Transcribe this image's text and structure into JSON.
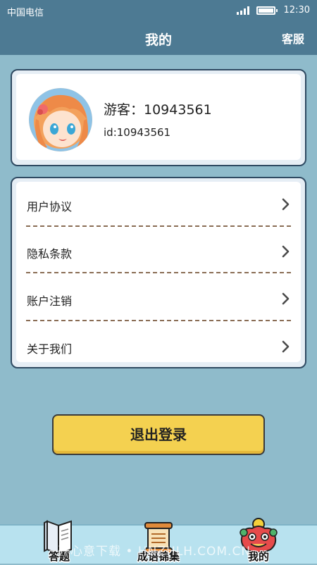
{
  "status_bar": {
    "carrier": "中国电信",
    "time": "12:30"
  },
  "header": {
    "title": "我的",
    "service_label": "客服"
  },
  "profile": {
    "display_name": "游客：10943561",
    "user_id": "id:10943561",
    "avatar_icon": "anime-girl-avatar"
  },
  "menu": {
    "items": [
      {
        "label": "用户协议",
        "icon": "chevron-right-icon"
      },
      {
        "label": "隐私条款",
        "icon": "chevron-right-icon"
      },
      {
        "label": "账户注销",
        "icon": "chevron-right-icon"
      },
      {
        "label": "关于我们",
        "icon": "chevron-right-icon"
      }
    ]
  },
  "logout_label": "退出登录",
  "tabs": [
    {
      "label": "答题",
      "icon": "book-icon"
    },
    {
      "label": "成语锦集",
      "icon": "scroll-icon"
    },
    {
      "label": "我的",
      "icon": "lion-head-icon"
    }
  ],
  "watermark": "开心意下载 • HNZHLH.COM.CN",
  "colors": {
    "header_bg": "#4d7a93",
    "page_bg": "#8fbbcb",
    "button_yellow": "#f4d150",
    "tabbar_bg": "#b8e2ef",
    "divider_brown": "#8a6d55"
  }
}
